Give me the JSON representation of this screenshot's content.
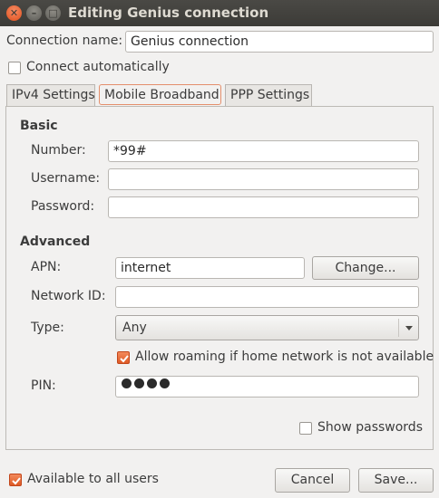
{
  "window": {
    "title": "Editing Genius connection",
    "close_glyph": "✕",
    "min_glyph": "–",
    "max_glyph": "□"
  },
  "connection_name": {
    "label": "Connection name:",
    "value": "Genius connection"
  },
  "connect_automatically": {
    "label": "Connect automatically",
    "checked": false
  },
  "tabs": [
    {
      "label": "IPv4 Settings",
      "active": false
    },
    {
      "label": "Mobile Broadband",
      "active": true
    },
    {
      "label": "PPP Settings",
      "active": false
    }
  ],
  "basic": {
    "heading": "Basic",
    "number": {
      "label": "Number:",
      "value": "*99#"
    },
    "username": {
      "label": "Username:",
      "value": ""
    },
    "password": {
      "label": "Password:",
      "value": ""
    }
  },
  "advanced": {
    "heading": "Advanced",
    "apn": {
      "label": "APN:",
      "value": "internet",
      "change_button": "Change..."
    },
    "network_id": {
      "label": "Network ID:",
      "value": ""
    },
    "type": {
      "label": "Type:",
      "selected": "Any"
    },
    "allow_roaming": {
      "label": "Allow roaming if home network is not available",
      "checked": true
    },
    "pin": {
      "label": "PIN:",
      "masked_length": 4
    }
  },
  "show_passwords": {
    "label": "Show passwords",
    "checked": false
  },
  "available_to_all_users": {
    "label": "Available to all users",
    "checked": true
  },
  "buttons": {
    "cancel": "Cancel",
    "save": "Save..."
  },
  "colors": {
    "accent": "#e05a20",
    "titlebar": "#3c3b37",
    "window_bg": "#f2f1f0"
  }
}
